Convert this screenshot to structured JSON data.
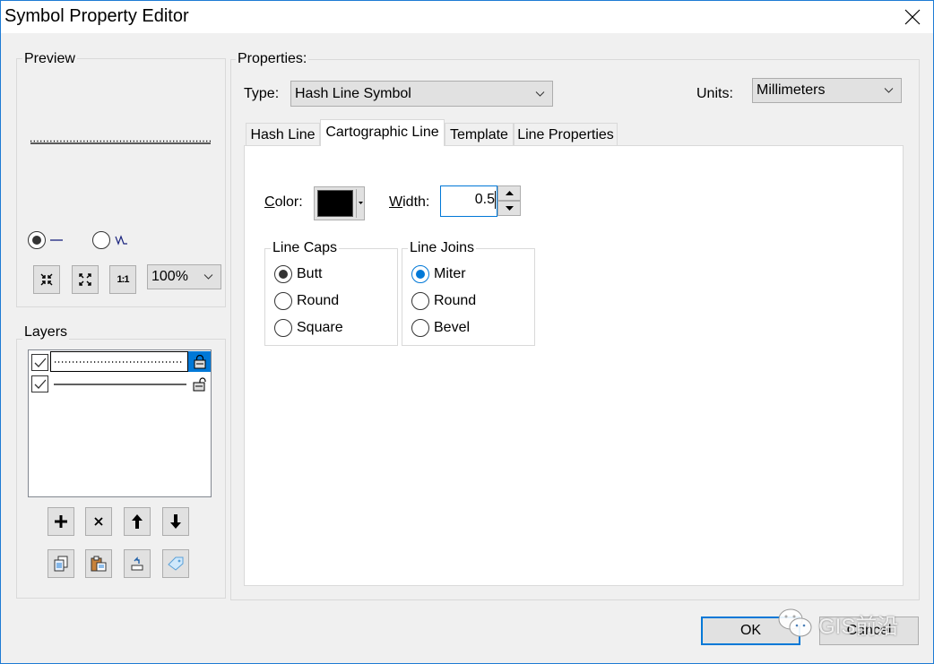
{
  "window": {
    "title": "Symbol Property Editor",
    "close_icon": "close-icon"
  },
  "preview": {
    "label": "Preview",
    "line_style": "hash-line",
    "mode_options": [
      {
        "name": "straight-line",
        "glyph": "—",
        "checked": true
      },
      {
        "name": "zigzag-line",
        "glyph": "\\/\\",
        "checked": false
      }
    ],
    "buttons": [
      {
        "name": "zoom-in-button",
        "icon": "zoom-in-icon"
      },
      {
        "name": "zoom-out-button",
        "icon": "zoom-out-icon"
      },
      {
        "name": "actual-size-button",
        "icon": "one-to-one-icon",
        "glyph": "1:1"
      }
    ],
    "zoom_value": "100%"
  },
  "layers": {
    "label": "Layers",
    "items": [
      {
        "visible": true,
        "style": "dotted",
        "locked": true,
        "selected": true
      },
      {
        "visible": true,
        "style": "solid",
        "locked": false,
        "selected": false
      }
    ],
    "buttons_row1": [
      {
        "name": "add-layer-button",
        "icon": "plus-icon",
        "glyph": "+"
      },
      {
        "name": "remove-layer-button",
        "icon": "delete-icon",
        "glyph": "×"
      },
      {
        "name": "move-up-button",
        "icon": "arrow-up-icon",
        "glyph": "↑"
      },
      {
        "name": "move-down-button",
        "icon": "arrow-down-icon",
        "glyph": "↓"
      }
    ],
    "buttons_row2": [
      {
        "name": "copy-layer-button",
        "icon": "copy-icon"
      },
      {
        "name": "paste-layer-button",
        "icon": "paste-icon"
      },
      {
        "name": "reset-layer-button",
        "icon": "undo-icon"
      },
      {
        "name": "tag-layer-button",
        "icon": "tag-icon"
      }
    ]
  },
  "properties": {
    "label": "Properties:",
    "type_label": "Type:",
    "type_value": "Hash Line Symbol",
    "units_label": "Units:",
    "units_value": "Millimeters",
    "tabs": [
      {
        "label": "Hash Line",
        "active": false
      },
      {
        "label": "Cartographic Line",
        "active": true
      },
      {
        "label": "Template",
        "active": false
      },
      {
        "label": "Line Properties",
        "active": false
      }
    ],
    "color_label": "Color:",
    "color_label_access_key": "C",
    "color_label_rest": "olor:",
    "color_value": "#000000",
    "width_label_access_key": "W",
    "width_label_rest": "idth:",
    "width_value": "0.5",
    "line_caps": {
      "label": "Line Caps",
      "options": [
        "Butt",
        "Round",
        "Square"
      ],
      "selected": "Butt"
    },
    "line_joins": {
      "label": "Line Joins",
      "options": [
        "Miter",
        "Round",
        "Bevel"
      ],
      "selected": "Miter"
    }
  },
  "footer": {
    "ok_label": "OK",
    "cancel_label": "Cancel"
  },
  "watermark": {
    "text": "GIS前沿",
    "icon": "wechat-icon"
  },
  "colors": {
    "accent": "#0078d7",
    "window_border": "#1e7bd4",
    "background": "#f0f0f0",
    "button_face": "#e1e1e1"
  }
}
